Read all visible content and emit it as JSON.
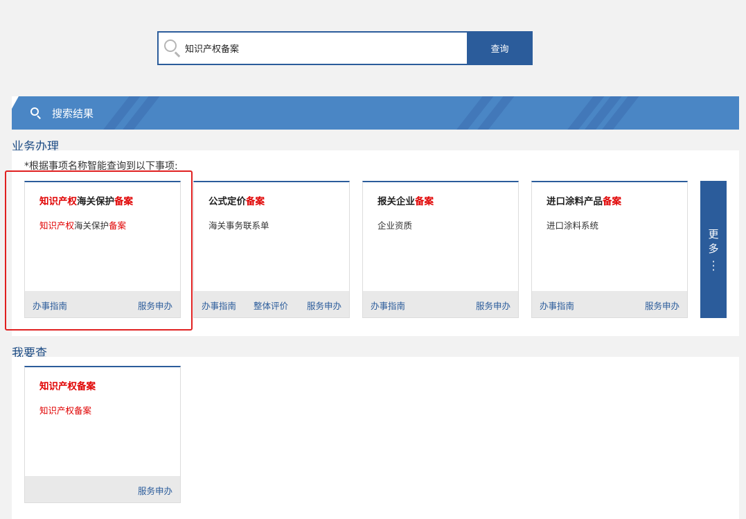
{
  "search": {
    "query": "知识产权备案",
    "button": "查询"
  },
  "banner": {
    "title": "搜索结果"
  },
  "business": {
    "section_title": "业务办理",
    "hint": "*根据事项名称智能查询到以下事项:",
    "cards": [
      {
        "title_parts": [
          "知识产权",
          "海关保护",
          "备案"
        ],
        "sub_parts": [
          "知识产权",
          "海关保护",
          "备案"
        ],
        "guide": "办事指南",
        "apply": "服务申办"
      },
      {
        "title_parts": [
          "公式定价",
          "备案"
        ],
        "sub": "海关事务联系单",
        "guide": "办事指南",
        "eval": "整体评价",
        "apply": "服务申办"
      },
      {
        "title_parts": [
          "报关企业",
          "备案"
        ],
        "sub": "企业资质",
        "guide": "办事指南",
        "apply": "服务申办"
      },
      {
        "title_parts": [
          "进口涂料产品",
          "备案"
        ],
        "sub": "进口涂料系统",
        "guide": "办事指南",
        "apply": "服务申办"
      }
    ],
    "more": [
      "更",
      "多"
    ]
  },
  "query": {
    "section_title": "我要查",
    "card": {
      "title": "知识产权备案",
      "sub": "知识产权备案",
      "apply": "服务申办"
    }
  },
  "colors": {
    "primary": "#2b5c9b",
    "banner": "#4a86c5",
    "highlight": "#e00000",
    "annotation": "#e02020"
  }
}
